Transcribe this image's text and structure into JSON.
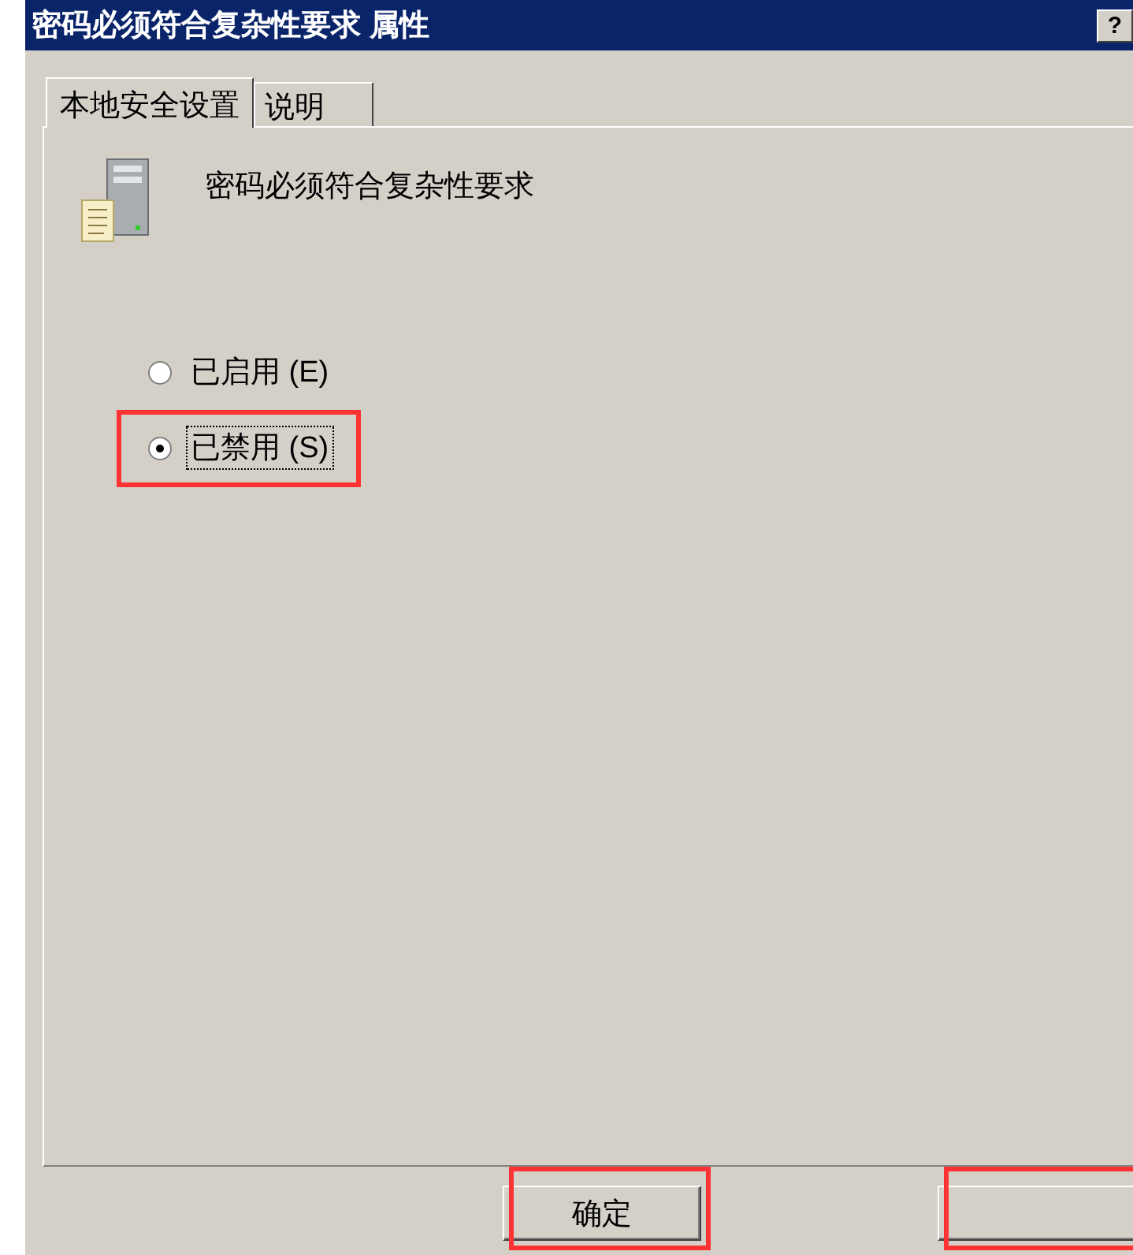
{
  "window": {
    "title": "密码必须符合复杂性要求 属性",
    "title_buttons": [
      "?"
    ]
  },
  "tabs": [
    {
      "label": "本地安全设置",
      "selected": true
    },
    {
      "label": "说明",
      "selected": false
    }
  ],
  "policy": {
    "name": "密码必须符合复杂性要求"
  },
  "options": [
    {
      "label": "已启用 (E)",
      "selected": false,
      "highlighted": false
    },
    {
      "label": "已禁用 (S)",
      "selected": true,
      "highlighted": true
    }
  ],
  "buttons": [
    {
      "label": "确定",
      "highlighted": true
    },
    {
      "highlighted": true
    }
  ]
}
